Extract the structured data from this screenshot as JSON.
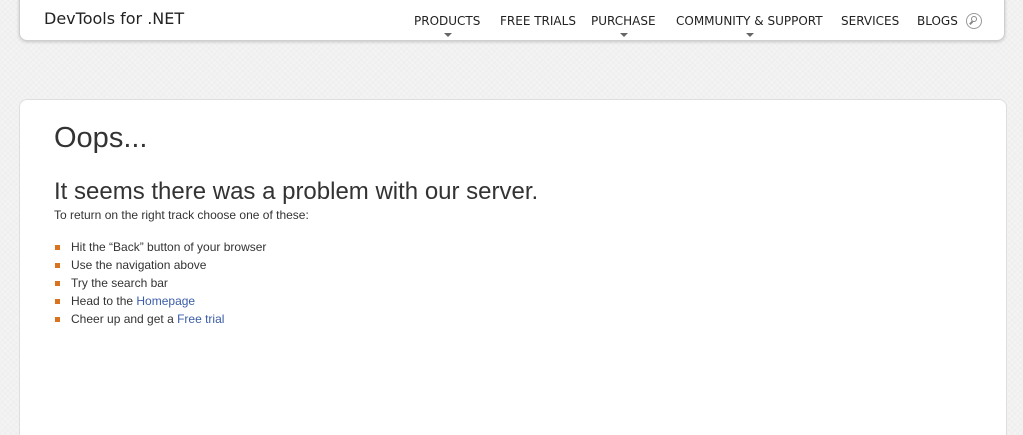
{
  "header": {
    "brand": "DevTools for .NET",
    "nav": [
      {
        "label": "PRODUCTS",
        "has_dropdown": true
      },
      {
        "label": "FREE TRIALS",
        "has_dropdown": false
      },
      {
        "label": "PURCHASE",
        "has_dropdown": true
      },
      {
        "label": "COMMUNITY & SUPPORT",
        "has_dropdown": true
      },
      {
        "label": "SERVICES",
        "has_dropdown": false
      },
      {
        "label": "BLOGS",
        "has_dropdown": false
      }
    ],
    "search_icon": "search-icon"
  },
  "error": {
    "title": "Oops...",
    "subtitle": "It seems there was a problem with our server.",
    "intro": "To return on the right track choose one of these:",
    "tips": {
      "back_prefix": "Hit the “Back” button of your browser",
      "nav": "Use the navigation above",
      "search": "Try the search bar",
      "home_prefix": "Head to the ",
      "home_link": "Homepage",
      "trial_prefix": "Cheer up and get a ",
      "trial_link": "Free trial"
    }
  },
  "colors": {
    "bullet": "#d9731f",
    "link": "#3a5ca8",
    "page_bg": "#f4f4f4"
  }
}
